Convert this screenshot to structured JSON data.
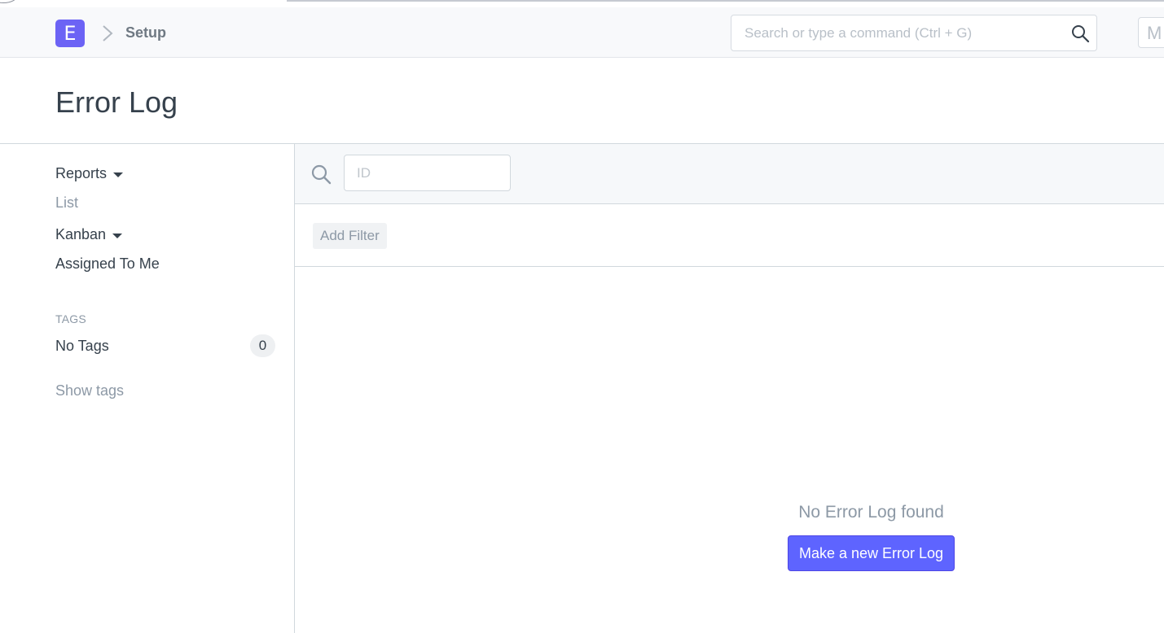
{
  "navbar": {
    "logo_letter": "E",
    "breadcrumb": "Setup",
    "search_placeholder": "Search or type a command (Ctrl + G)",
    "avatar_initial": "M"
  },
  "page": {
    "title": "Error Log"
  },
  "sidebar": {
    "reports_label": "Reports",
    "list_label": "List",
    "kanban_label": "Kanban",
    "assigned_label": "Assigned To Me",
    "tags_heading": "TAGS",
    "no_tags_label": "No Tags",
    "no_tags_count": "0",
    "show_tags_label": "Show tags"
  },
  "list": {
    "id_placeholder": "ID",
    "add_filter_label": "Add Filter",
    "empty_message": "No Error Log found",
    "new_button_label": "Make a new Error Log"
  },
  "colors": {
    "brand": "#6c63f5",
    "primary_button": "#5e64ff"
  }
}
